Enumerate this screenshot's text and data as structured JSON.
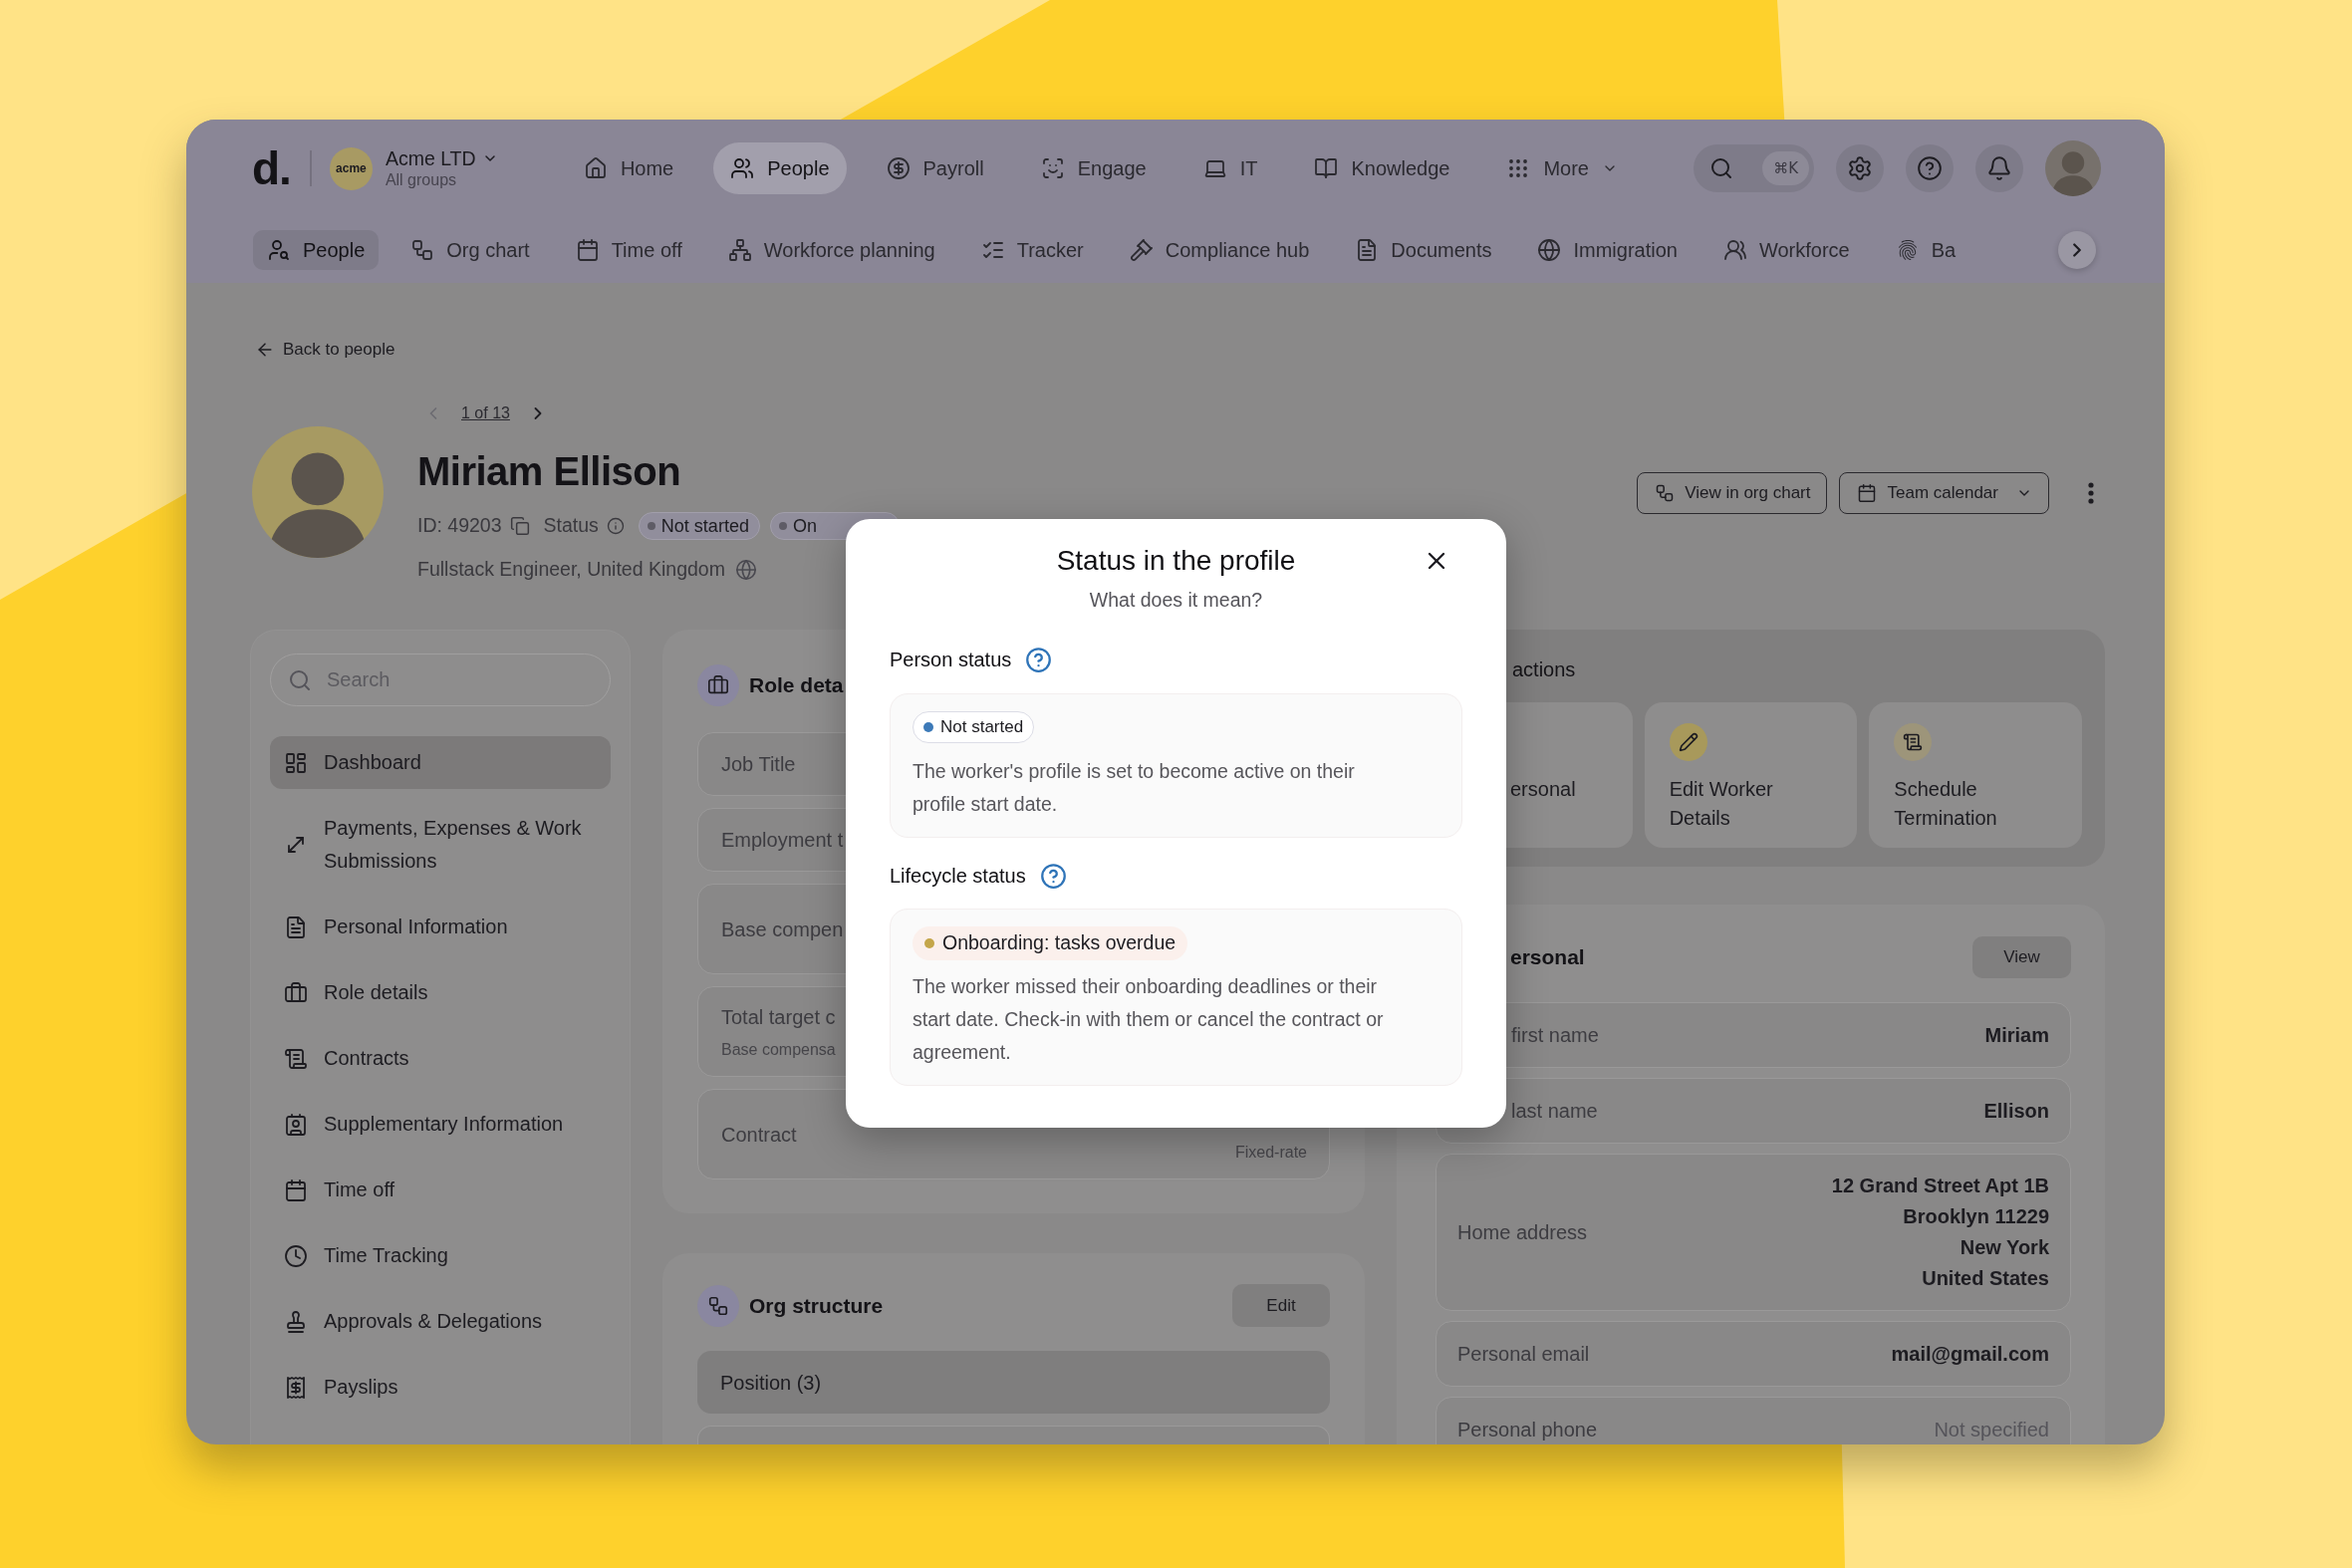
{
  "nav": {
    "logo": "d.",
    "company": {
      "logo_text": "acme",
      "name": "Acme LTD",
      "subtitle": "All groups"
    },
    "items": [
      {
        "label": "Home",
        "selected": false
      },
      {
        "label": "People",
        "selected": true
      },
      {
        "label": "Payroll",
        "selected": false
      },
      {
        "label": "Engage",
        "selected": false
      },
      {
        "label": "IT",
        "selected": false
      },
      {
        "label": "Knowledge",
        "selected": false
      }
    ],
    "more": "More",
    "search_shortcut": "⌘K"
  },
  "subnav": {
    "items": [
      {
        "label": "People",
        "selected": true
      },
      {
        "label": "Org chart",
        "selected": false
      },
      {
        "label": "Time off",
        "selected": false
      },
      {
        "label": "Workforce planning",
        "selected": false
      },
      {
        "label": "Tracker",
        "selected": false
      },
      {
        "label": "Compliance hub",
        "selected": false
      },
      {
        "label": "Documents",
        "selected": false
      },
      {
        "label": "Immigration",
        "selected": false
      },
      {
        "label": "Workforce",
        "selected": false
      },
      {
        "label": "Ba",
        "selected": false
      }
    ]
  },
  "back_link": "Back to people",
  "pager": {
    "label": "1 of 13",
    "prev_disabled": true,
    "next_disabled": false
  },
  "profile": {
    "name": "Miriam Ellison",
    "id": "ID: 49203",
    "status_label": "Status",
    "badges": [
      {
        "label": "Not started",
        "kind": "full"
      },
      {
        "label": "On",
        "kind": "clipped"
      }
    ],
    "subtitle": "Fullstack Engineer, United Kingdom",
    "actions": [
      {
        "label": "View in org chart",
        "kind": "button"
      },
      {
        "label": "Team calendar",
        "kind": "dropdown"
      }
    ]
  },
  "sidebar": {
    "search_placeholder": "Search",
    "items": [
      {
        "label": "Dashboard",
        "selected": true
      },
      {
        "label": "Payments, Expenses & Work Submissions",
        "selected": false
      },
      {
        "label": "Personal Information",
        "selected": false
      },
      {
        "label": "Role details",
        "selected": false
      },
      {
        "label": "Contracts",
        "selected": false
      },
      {
        "label": "Supplementary Information",
        "selected": false
      },
      {
        "label": "Time off",
        "selected": false
      },
      {
        "label": "Time Tracking",
        "selected": false
      },
      {
        "label": "Approvals & Delegations",
        "selected": false
      },
      {
        "label": "Payslips",
        "selected": false
      }
    ]
  },
  "role_card": {
    "title": "Role deta",
    "rows": [
      {
        "label": "Job Title",
        "kind": "single"
      },
      {
        "label": "Employment t",
        "kind": "single"
      },
      {
        "label": "Base compen",
        "kind": "double"
      },
      {
        "label": "Total target c",
        "note": "Base compensa",
        "kind": "double"
      },
      {
        "label": "Contract",
        "value_note": "Fixed-rate",
        "kind": "double"
      }
    ]
  },
  "org_card": {
    "title": "Org structure",
    "button": "Edit",
    "rows": [
      "Position (3)"
    ]
  },
  "quick_actions": {
    "title": "actions",
    "tiles": [
      {
        "label": "ersonal",
        "kind": "clipped"
      },
      {
        "label": "Edit Worker Details",
        "kind": "action"
      },
      {
        "label": "Schedule Termination",
        "kind": "action"
      }
    ]
  },
  "personal_card": {
    "title": "ersonal",
    "button": "View",
    "rows": [
      {
        "label": "first name",
        "value": "Miriam",
        "kind": "clipped"
      },
      {
        "label": "last name",
        "value": "Ellison",
        "kind": "clipped"
      },
      {
        "label": "Home address",
        "lines": [
          "12 Grand Street Apt 1B",
          "Brooklyn 11229",
          "New York",
          "United States"
        ],
        "kind": "address"
      },
      {
        "label": "Personal email",
        "value": "mail@gmail.com",
        "kind": "value"
      },
      {
        "label": "Personal phone",
        "value": "Not specified",
        "kind": "missing"
      }
    ]
  },
  "modal": {
    "title": "Status in the profile",
    "subtitle": "What does it mean?",
    "sections": [
      {
        "heading": "Person status",
        "badge": {
          "label": "Not started",
          "color": "#3d7ab8",
          "kind": "outline"
        },
        "text": "The worker's profile is set to become active on their profile start date."
      },
      {
        "heading": "Lifecycle status",
        "badge": {
          "label": "Onboarding: tasks overdue",
          "color": "#c4a64a",
          "kind": "tinted"
        },
        "text": "The worker missed their onboarding deadlines or their start date. Check-in with them or cancel the contract or agreement."
      }
    ]
  }
}
